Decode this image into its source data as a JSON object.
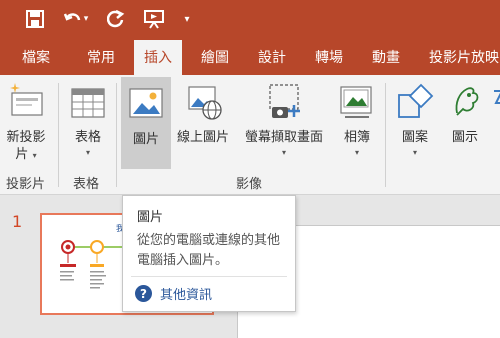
{
  "quick_access": {
    "save_icon": "save-icon",
    "undo_icon": "undo-icon",
    "undo_dropdown": "▾",
    "redo_icon": "repeat-icon",
    "present_icon": "present-from-beginning-icon",
    "customize": "▾"
  },
  "tabs": [
    "檔案",
    "常用",
    "插入",
    "繪圖",
    "設計",
    "轉場",
    "動畫",
    "投影片放映"
  ],
  "ribbon": {
    "new_slide": {
      "line1": "新投影",
      "line2": "片",
      "arrow": "▾"
    },
    "table": {
      "label": "表格",
      "arrow": "▾"
    },
    "picture": {
      "label": "圖片"
    },
    "online_picture": {
      "label": "線上圖片"
    },
    "screenshot": {
      "label": "螢幕擷取畫面",
      "arrow": "▾"
    },
    "album": {
      "label": "相簿",
      "arrow": "▾"
    },
    "shapes": {
      "label": "圖案",
      "arrow": "▾"
    },
    "icons": {
      "label": "圖示"
    },
    "groups": {
      "slides": "投影片",
      "tables": "表格",
      "images": "影像"
    }
  },
  "slides": {
    "number": "1",
    "thumb_title": "我是"
  },
  "tooltip": {
    "title": "圖片",
    "description": "從您的電腦或連線的其他電腦插入圖片。",
    "more": "其他資訊",
    "help_symbol": "?"
  },
  "colors": {
    "accent": "#b7472a",
    "ribbon": "#f3f3f3",
    "help": "#2b579a"
  }
}
